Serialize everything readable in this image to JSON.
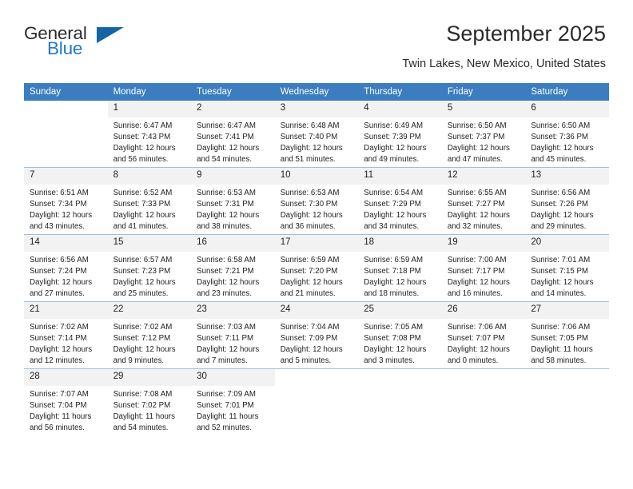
{
  "brand": {
    "name_top": "General",
    "name_bottom": "Blue"
  },
  "header": {
    "month_title": "September 2025",
    "location": "Twin Lakes, New Mexico, United States"
  },
  "colors": {
    "header_blue": "#3b7dbf",
    "brand_blue": "#2079c7",
    "triangle_blue": "#1565a6",
    "daynum_bg": "#f2f2f2",
    "row_divider": "#9fc0de"
  },
  "weekdays": [
    "Sunday",
    "Monday",
    "Tuesday",
    "Wednesday",
    "Thursday",
    "Friday",
    "Saturday"
  ],
  "weeks": [
    [
      {
        "day": "",
        "sunrise": "",
        "sunset": "",
        "daylight_1": "",
        "daylight_2": "",
        "blank": true
      },
      {
        "day": "1",
        "sunrise": "Sunrise: 6:47 AM",
        "sunset": "Sunset: 7:43 PM",
        "daylight_1": "Daylight: 12 hours",
        "daylight_2": "and 56 minutes."
      },
      {
        "day": "2",
        "sunrise": "Sunrise: 6:47 AM",
        "sunset": "Sunset: 7:41 PM",
        "daylight_1": "Daylight: 12 hours",
        "daylight_2": "and 54 minutes."
      },
      {
        "day": "3",
        "sunrise": "Sunrise: 6:48 AM",
        "sunset": "Sunset: 7:40 PM",
        "daylight_1": "Daylight: 12 hours",
        "daylight_2": "and 51 minutes."
      },
      {
        "day": "4",
        "sunrise": "Sunrise: 6:49 AM",
        "sunset": "Sunset: 7:39 PM",
        "daylight_1": "Daylight: 12 hours",
        "daylight_2": "and 49 minutes."
      },
      {
        "day": "5",
        "sunrise": "Sunrise: 6:50 AM",
        "sunset": "Sunset: 7:37 PM",
        "daylight_1": "Daylight: 12 hours",
        "daylight_2": "and 47 minutes."
      },
      {
        "day": "6",
        "sunrise": "Sunrise: 6:50 AM",
        "sunset": "Sunset: 7:36 PM",
        "daylight_1": "Daylight: 12 hours",
        "daylight_2": "and 45 minutes."
      }
    ],
    [
      {
        "day": "7",
        "sunrise": "Sunrise: 6:51 AM",
        "sunset": "Sunset: 7:34 PM",
        "daylight_1": "Daylight: 12 hours",
        "daylight_2": "and 43 minutes."
      },
      {
        "day": "8",
        "sunrise": "Sunrise: 6:52 AM",
        "sunset": "Sunset: 7:33 PM",
        "daylight_1": "Daylight: 12 hours",
        "daylight_2": "and 41 minutes."
      },
      {
        "day": "9",
        "sunrise": "Sunrise: 6:53 AM",
        "sunset": "Sunset: 7:31 PM",
        "daylight_1": "Daylight: 12 hours",
        "daylight_2": "and 38 minutes."
      },
      {
        "day": "10",
        "sunrise": "Sunrise: 6:53 AM",
        "sunset": "Sunset: 7:30 PM",
        "daylight_1": "Daylight: 12 hours",
        "daylight_2": "and 36 minutes."
      },
      {
        "day": "11",
        "sunrise": "Sunrise: 6:54 AM",
        "sunset": "Sunset: 7:29 PM",
        "daylight_1": "Daylight: 12 hours",
        "daylight_2": "and 34 minutes."
      },
      {
        "day": "12",
        "sunrise": "Sunrise: 6:55 AM",
        "sunset": "Sunset: 7:27 PM",
        "daylight_1": "Daylight: 12 hours",
        "daylight_2": "and 32 minutes."
      },
      {
        "day": "13",
        "sunrise": "Sunrise: 6:56 AM",
        "sunset": "Sunset: 7:26 PM",
        "daylight_1": "Daylight: 12 hours",
        "daylight_2": "and 29 minutes."
      }
    ],
    [
      {
        "day": "14",
        "sunrise": "Sunrise: 6:56 AM",
        "sunset": "Sunset: 7:24 PM",
        "daylight_1": "Daylight: 12 hours",
        "daylight_2": "and 27 minutes."
      },
      {
        "day": "15",
        "sunrise": "Sunrise: 6:57 AM",
        "sunset": "Sunset: 7:23 PM",
        "daylight_1": "Daylight: 12 hours",
        "daylight_2": "and 25 minutes."
      },
      {
        "day": "16",
        "sunrise": "Sunrise: 6:58 AM",
        "sunset": "Sunset: 7:21 PM",
        "daylight_1": "Daylight: 12 hours",
        "daylight_2": "and 23 minutes."
      },
      {
        "day": "17",
        "sunrise": "Sunrise: 6:59 AM",
        "sunset": "Sunset: 7:20 PM",
        "daylight_1": "Daylight: 12 hours",
        "daylight_2": "and 21 minutes."
      },
      {
        "day": "18",
        "sunrise": "Sunrise: 6:59 AM",
        "sunset": "Sunset: 7:18 PM",
        "daylight_1": "Daylight: 12 hours",
        "daylight_2": "and 18 minutes."
      },
      {
        "day": "19",
        "sunrise": "Sunrise: 7:00 AM",
        "sunset": "Sunset: 7:17 PM",
        "daylight_1": "Daylight: 12 hours",
        "daylight_2": "and 16 minutes."
      },
      {
        "day": "20",
        "sunrise": "Sunrise: 7:01 AM",
        "sunset": "Sunset: 7:15 PM",
        "daylight_1": "Daylight: 12 hours",
        "daylight_2": "and 14 minutes."
      }
    ],
    [
      {
        "day": "21",
        "sunrise": "Sunrise: 7:02 AM",
        "sunset": "Sunset: 7:14 PM",
        "daylight_1": "Daylight: 12 hours",
        "daylight_2": "and 12 minutes."
      },
      {
        "day": "22",
        "sunrise": "Sunrise: 7:02 AM",
        "sunset": "Sunset: 7:12 PM",
        "daylight_1": "Daylight: 12 hours",
        "daylight_2": "and 9 minutes."
      },
      {
        "day": "23",
        "sunrise": "Sunrise: 7:03 AM",
        "sunset": "Sunset: 7:11 PM",
        "daylight_1": "Daylight: 12 hours",
        "daylight_2": "and 7 minutes."
      },
      {
        "day": "24",
        "sunrise": "Sunrise: 7:04 AM",
        "sunset": "Sunset: 7:09 PM",
        "daylight_1": "Daylight: 12 hours",
        "daylight_2": "and 5 minutes."
      },
      {
        "day": "25",
        "sunrise": "Sunrise: 7:05 AM",
        "sunset": "Sunset: 7:08 PM",
        "daylight_1": "Daylight: 12 hours",
        "daylight_2": "and 3 minutes."
      },
      {
        "day": "26",
        "sunrise": "Sunrise: 7:06 AM",
        "sunset": "Sunset: 7:07 PM",
        "daylight_1": "Daylight: 12 hours",
        "daylight_2": "and 0 minutes."
      },
      {
        "day": "27",
        "sunrise": "Sunrise: 7:06 AM",
        "sunset": "Sunset: 7:05 PM",
        "daylight_1": "Daylight: 11 hours",
        "daylight_2": "and 58 minutes."
      }
    ],
    [
      {
        "day": "28",
        "sunrise": "Sunrise: 7:07 AM",
        "sunset": "Sunset: 7:04 PM",
        "daylight_1": "Daylight: 11 hours",
        "daylight_2": "and 56 minutes."
      },
      {
        "day": "29",
        "sunrise": "Sunrise: 7:08 AM",
        "sunset": "Sunset: 7:02 PM",
        "daylight_1": "Daylight: 11 hours",
        "daylight_2": "and 54 minutes."
      },
      {
        "day": "30",
        "sunrise": "Sunrise: 7:09 AM",
        "sunset": "Sunset: 7:01 PM",
        "daylight_1": "Daylight: 11 hours",
        "daylight_2": "and 52 minutes."
      },
      {
        "day": "",
        "sunrise": "",
        "sunset": "",
        "daylight_1": "",
        "daylight_2": "",
        "blank": true
      },
      {
        "day": "",
        "sunrise": "",
        "sunset": "",
        "daylight_1": "",
        "daylight_2": "",
        "blank": true
      },
      {
        "day": "",
        "sunrise": "",
        "sunset": "",
        "daylight_1": "",
        "daylight_2": "",
        "blank": true
      },
      {
        "day": "",
        "sunrise": "",
        "sunset": "",
        "daylight_1": "",
        "daylight_2": "",
        "blank": true
      }
    ]
  ]
}
